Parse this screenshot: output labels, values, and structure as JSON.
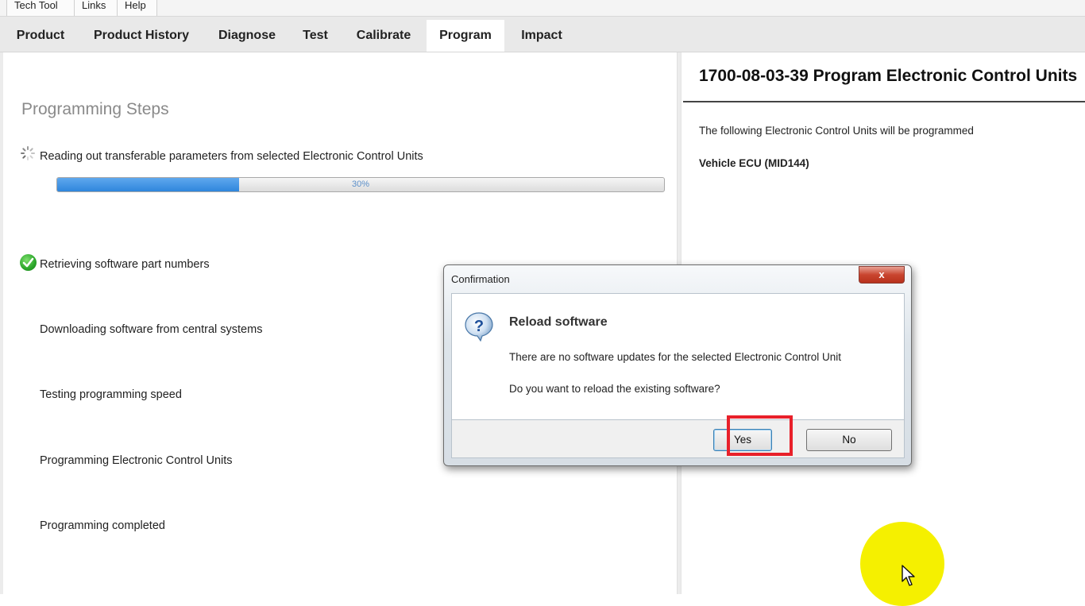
{
  "menubar": {
    "items": [
      {
        "label": "Tech Tool"
      },
      {
        "label": "Links"
      },
      {
        "label": "Help"
      }
    ]
  },
  "tabs": [
    {
      "label": "Product"
    },
    {
      "label": "Product History"
    },
    {
      "label": "Diagnose"
    },
    {
      "label": "Test"
    },
    {
      "label": "Calibrate"
    },
    {
      "label": "Program",
      "active": true
    },
    {
      "label": "Impact"
    }
  ],
  "steps": {
    "title": "Programming Steps",
    "items": [
      {
        "label": "Reading out transferable parameters from selected Electronic Control Units",
        "status": "in-progress"
      },
      {
        "label": "Retrieving software part numbers",
        "status": "done"
      },
      {
        "label": "Downloading software from central systems",
        "status": "pending"
      },
      {
        "label": "Testing programming speed",
        "status": "pending"
      },
      {
        "label": "Programming Electronic Control Units",
        "status": "pending"
      },
      {
        "label": "Programming completed",
        "status": "pending"
      }
    ],
    "progress": {
      "percent": 30,
      "label": "30%"
    }
  },
  "detail": {
    "title": "1700-08-03-39 Program Electronic Control Units",
    "intro": "The following Electronic Control Units will be programmed",
    "ecu": "Vehicle ECU (MID144)"
  },
  "dialog": {
    "title": "Confirmation",
    "close_label": "x",
    "icon": "help-question-icon",
    "heading": "Reload software",
    "message": "There are no software updates for the selected Electronic Control Unit",
    "question": "Do you want to reload the existing software?",
    "yes_label": "Yes",
    "no_label": "No"
  },
  "colors": {
    "progress_fill": "#2f86dc",
    "highlight_box": "#e8202a",
    "cursor_glow": "#f5f000",
    "done_check": "#2aa52a"
  }
}
